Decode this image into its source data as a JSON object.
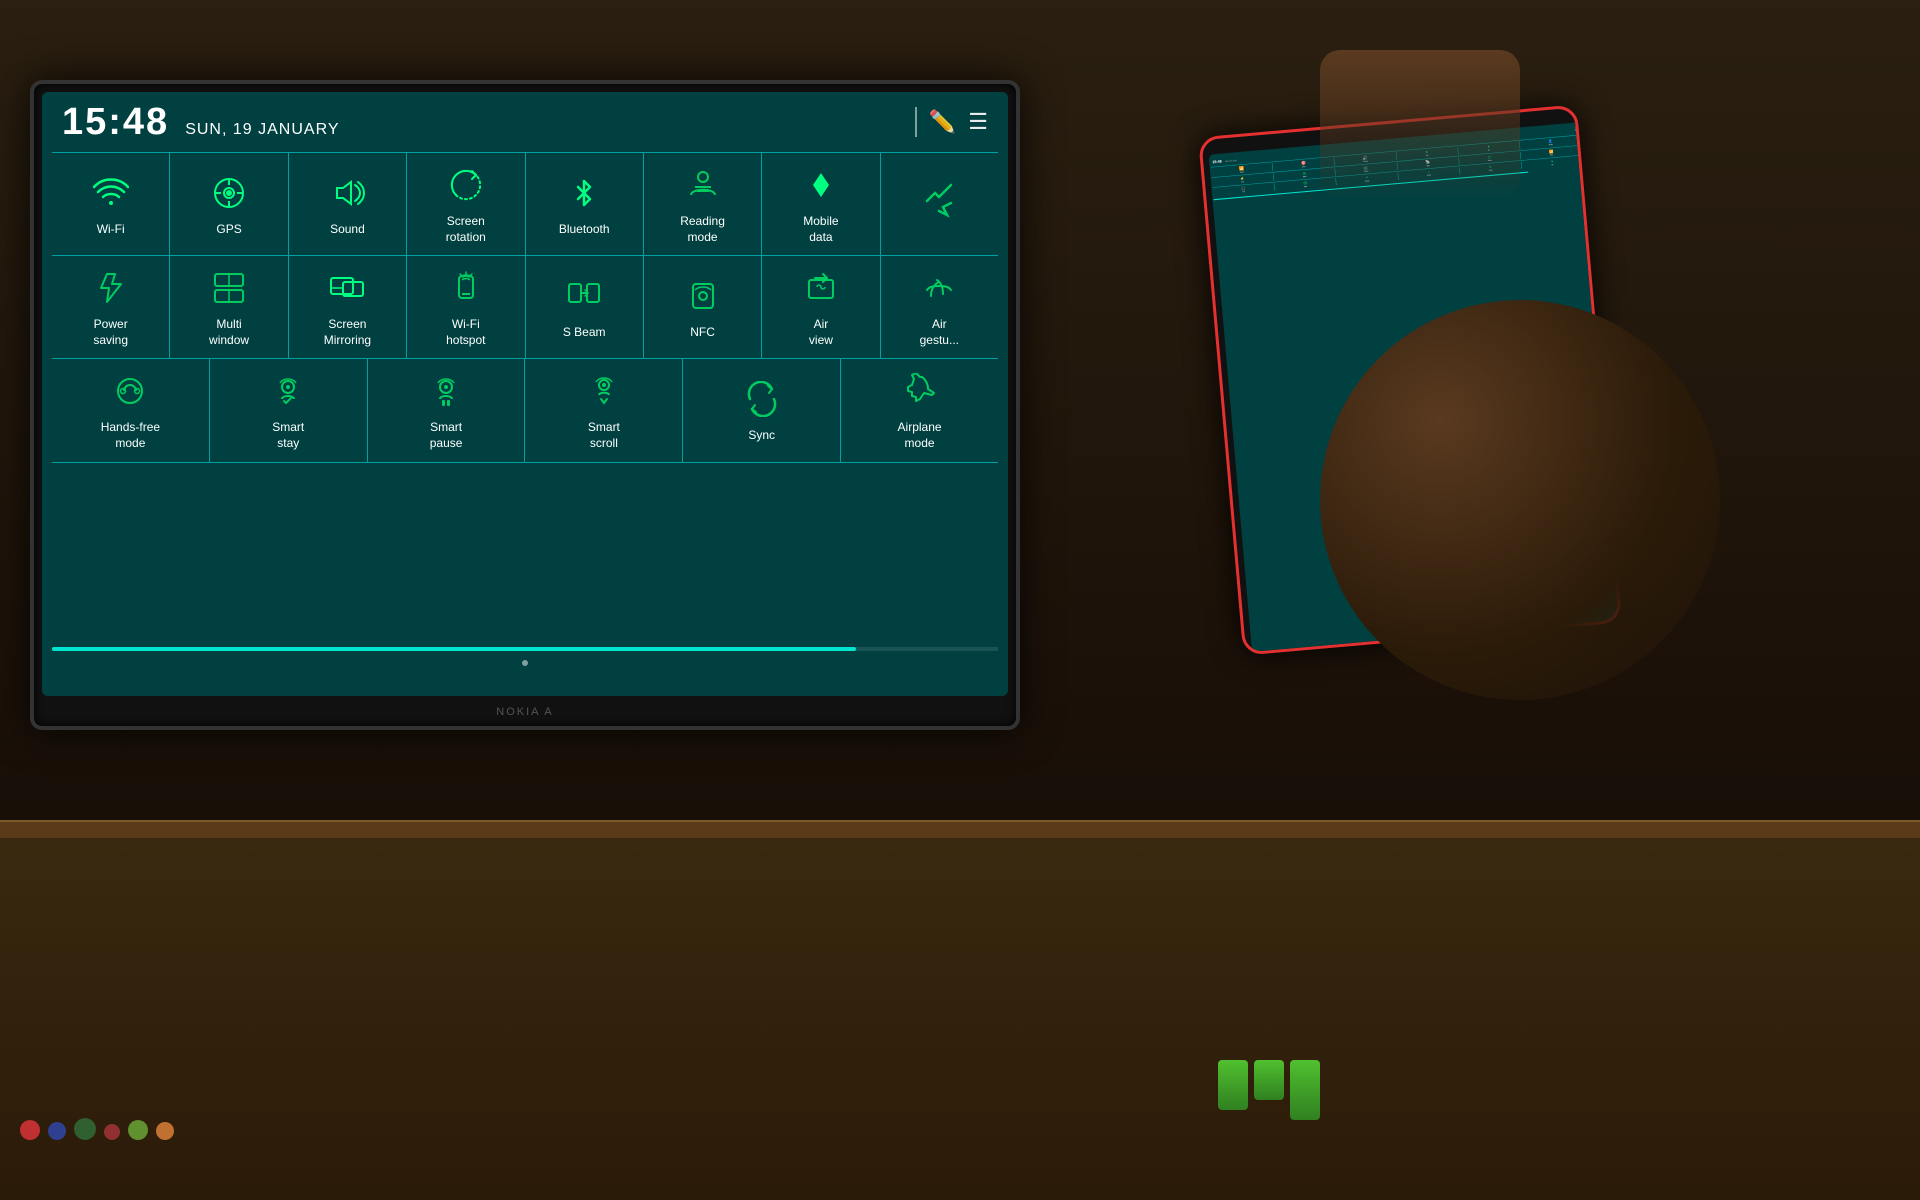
{
  "tv": {
    "time": "15:48",
    "date": "SUN, 19 JANUARY",
    "brand": "NOKIA A"
  },
  "quickSettings": {
    "rows": [
      {
        "id": "row1",
        "items": [
          {
            "id": "wifi",
            "label": "Wi-Fi",
            "icon": "wifi",
            "active": true
          },
          {
            "id": "gps",
            "label": "GPS",
            "icon": "gps",
            "active": true
          },
          {
            "id": "sound",
            "label": "Sound",
            "icon": "sound",
            "active": true
          },
          {
            "id": "screen-rotation",
            "label": "Screen\nrotation",
            "icon": "rotation",
            "active": true
          },
          {
            "id": "bluetooth",
            "label": "Bluetooth",
            "icon": "bluetooth",
            "active": true
          },
          {
            "id": "reading-mode",
            "label": "Reading\nmode",
            "icon": "reading",
            "active": false
          },
          {
            "id": "mobile-data",
            "label": "Mobile\ndata",
            "icon": "mobile-data",
            "active": true
          },
          {
            "id": "partial8",
            "label": "",
            "icon": "arrows",
            "active": false
          }
        ]
      },
      {
        "id": "row2",
        "items": [
          {
            "id": "power-saving",
            "label": "Power\nsaving",
            "icon": "power-saving",
            "active": false
          },
          {
            "id": "multi-window",
            "label": "Multi\nwindow",
            "icon": "multi-window",
            "active": false
          },
          {
            "id": "screen-mirroring",
            "label": "Screen\nMirroring",
            "icon": "screen-mirror",
            "active": true
          },
          {
            "id": "wifi-hotspot",
            "label": "Wi-Fi\nhotspot",
            "icon": "wifi-hotspot",
            "active": false
          },
          {
            "id": "s-beam",
            "label": "S Beam",
            "icon": "s-beam",
            "active": false
          },
          {
            "id": "nfc",
            "label": "NFC",
            "icon": "nfc",
            "active": false
          },
          {
            "id": "air-view",
            "label": "Air\nview",
            "icon": "air-view",
            "active": false
          },
          {
            "id": "air-gesture",
            "label": "Air\ngestu...",
            "icon": "air-gesture",
            "active": false
          }
        ]
      },
      {
        "id": "row3",
        "items": [
          {
            "id": "hands-free",
            "label": "Hands-free\nmode",
            "icon": "hands-free",
            "active": false
          },
          {
            "id": "smart-stay",
            "label": "Smart\nstay",
            "icon": "smart-stay",
            "active": false
          },
          {
            "id": "smart-pause",
            "label": "Smart\npause",
            "icon": "smart-pause",
            "active": false
          },
          {
            "id": "smart-scroll",
            "label": "Smart\nscroll",
            "icon": "smart-scroll",
            "active": false
          },
          {
            "id": "sync",
            "label": "Sync",
            "icon": "sync",
            "active": false
          },
          {
            "id": "airplane",
            "label": "Airplane\nmode",
            "icon": "airplane",
            "active": false
          }
        ]
      }
    ],
    "progressPercent": 85
  }
}
